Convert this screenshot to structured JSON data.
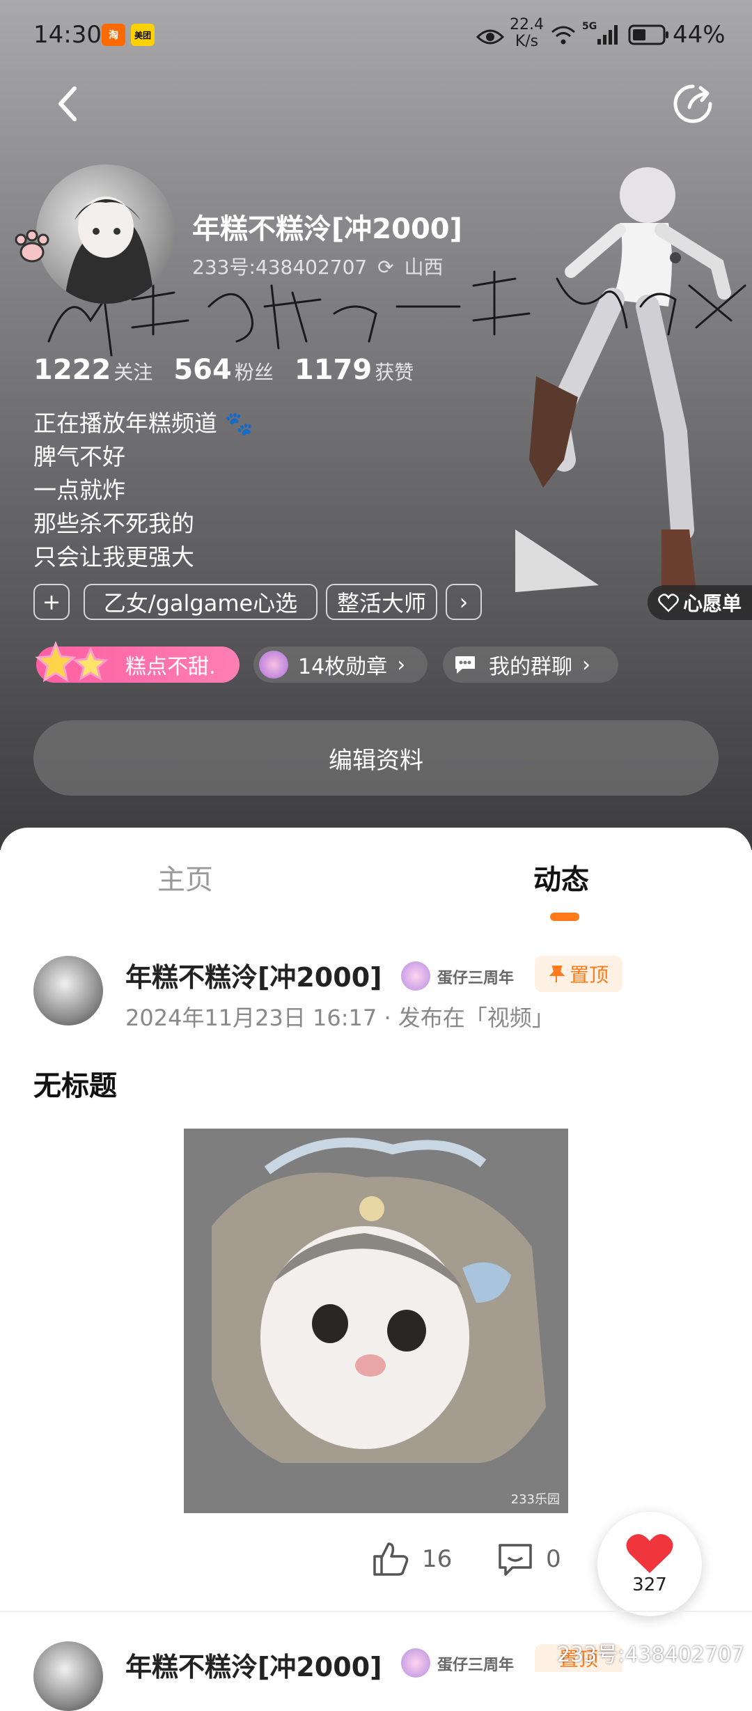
{
  "status_bar": {
    "time": "14:30",
    "app_badges": [
      "淘",
      "美团"
    ],
    "net_speed_value": "22.4",
    "net_speed_unit": "K/s",
    "network": "5G",
    "battery": "44%"
  },
  "profile": {
    "name": "年糕不糕泠[冲2000]",
    "id_text": "233号:438402707",
    "location": "山西",
    "signature_text": "我想成为一个幸福的人",
    "stats": [
      {
        "value": "1222",
        "label": "关注"
      },
      {
        "value": "564",
        "label": "粉丝"
      },
      {
        "value": "1179",
        "label": "获赞"
      }
    ],
    "bio_lines": [
      "正在播放年糕频道 🐾",
      "脾气不好",
      "一点就炸",
      "那些杀不死我的",
      "只会让我更强大"
    ],
    "tags": [
      "乙女/galgame心选",
      "整活大师"
    ],
    "add_tag": "+",
    "more_tags": "›",
    "wishlist": "心愿单",
    "level_badge": "糕点不甜.",
    "medals": "14枚勋章",
    "group_chat": "我的群聊",
    "edit_button": "编辑资料"
  },
  "tabs": [
    {
      "label": "主页",
      "active": false
    },
    {
      "label": "动态",
      "active": true
    }
  ],
  "post": {
    "author": "年糕不糕泠[冲2000]",
    "anniversary": "蛋仔三周年",
    "pin": "置顶",
    "meta": "2024年11月23日 16:17 · 发布在「视频」",
    "title": "无标题",
    "image_watermark": "233乐园",
    "likes": "16",
    "comments": "0",
    "hearts": "327"
  },
  "next_post": {
    "author": "年糕不糕泠[冲2000]",
    "anniversary": "蛋仔三周年",
    "pin": "置顶"
  },
  "watermark": "233号:438402707",
  "colors": {
    "accent": "#ff7a1a",
    "heart": "#f0353c",
    "pin_bg": "#fff1e4"
  }
}
